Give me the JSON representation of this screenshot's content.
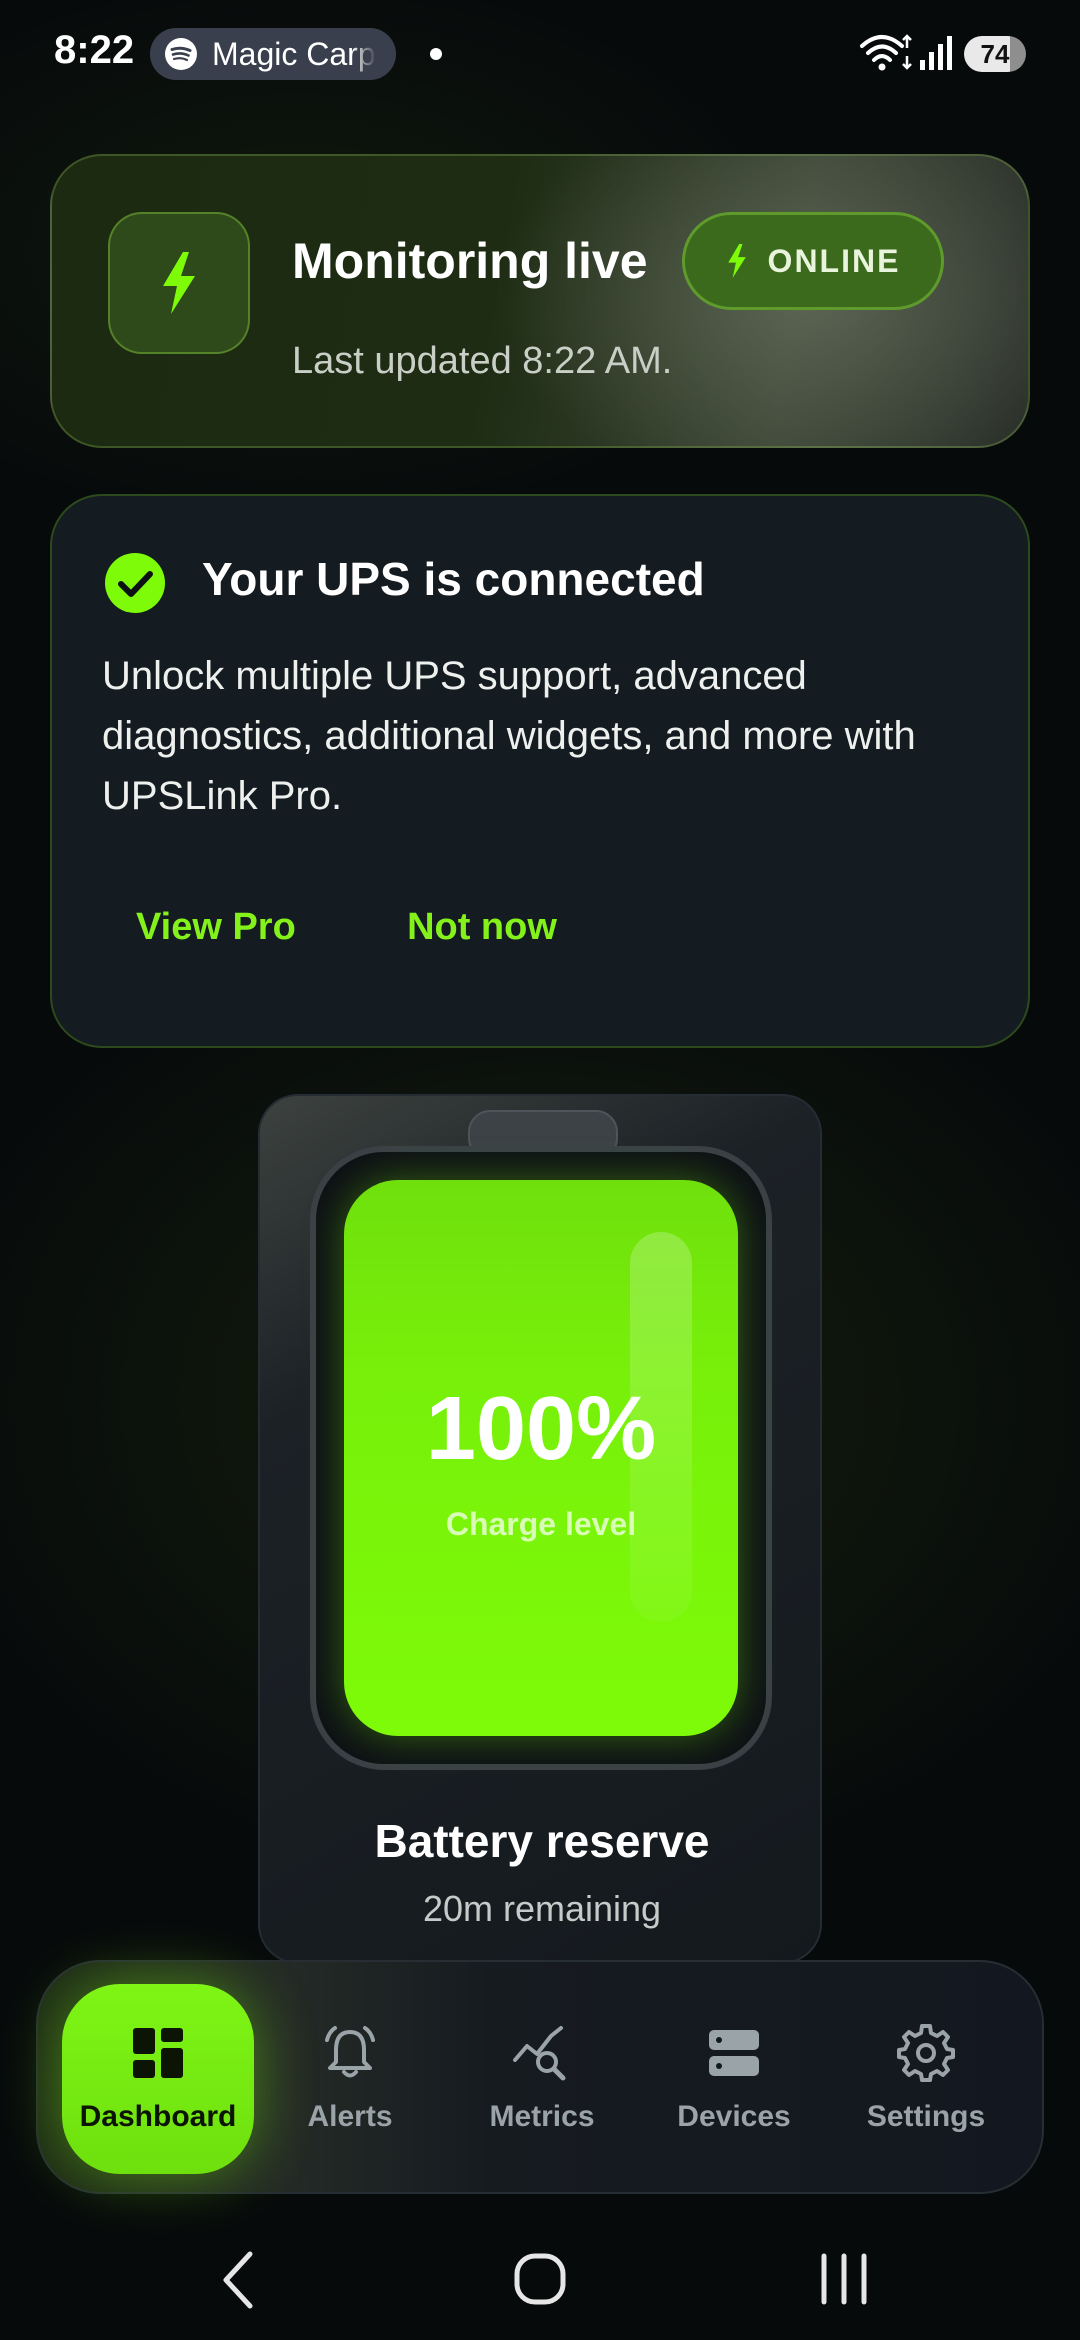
{
  "status_bar": {
    "time": "8:22",
    "media_app": "Magic Carp",
    "battery_level": "74"
  },
  "monitor": {
    "title": "Monitoring live",
    "subtitle": "Last updated 8:22 AM.",
    "status": "ONLINE"
  },
  "promo": {
    "title": "Your UPS is connected",
    "body": "Unlock multiple UPS support, advanced diagnostics, additional widgets, and more with UPSLink Pro.",
    "primary_action": "View Pro",
    "secondary_action": "Not now"
  },
  "battery": {
    "percent": "100%",
    "caption": "Charge level",
    "title": "Battery reserve",
    "remaining": "20m remaining",
    "fill_fraction": 1.0
  },
  "nav": {
    "items": [
      {
        "label": "Dashboard",
        "icon": "dashboard-icon",
        "active": true
      },
      {
        "label": "Alerts",
        "icon": "bell-icon",
        "active": false
      },
      {
        "label": "Metrics",
        "icon": "metrics-icon",
        "active": false
      },
      {
        "label": "Devices",
        "icon": "devices-icon",
        "active": false
      },
      {
        "label": "Settings",
        "icon": "gear-icon",
        "active": false
      }
    ]
  },
  "colors": {
    "accent": "#7dfb08",
    "background": "#070a0b",
    "card": "#141b21"
  }
}
